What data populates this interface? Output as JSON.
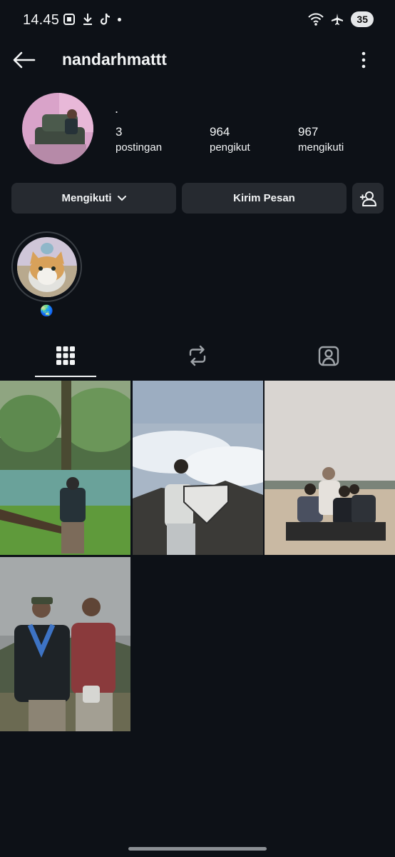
{
  "status_bar": {
    "time": "14.45",
    "battery": "35",
    "icons_left": [
      "screenshot-icon",
      "download-icon",
      "tiktok-icon",
      "dot-icon"
    ],
    "icons_right": [
      "wifi-icon",
      "airplane-icon"
    ]
  },
  "header": {
    "username": "nandarhmattt",
    "back_icon": "back-arrow-icon",
    "more_icon": "more-vertical-icon"
  },
  "profile": {
    "bio": ".",
    "stats": [
      {
        "value": "3",
        "label": "postingan"
      },
      {
        "value": "964",
        "label": "pengikut"
      },
      {
        "value": "967",
        "label": "mengikuti"
      }
    ]
  },
  "actions": {
    "follow_label": "Mengikuti",
    "message_label": "Kirim Pesan",
    "add_user_icon": "add-user-icon"
  },
  "highlight": {
    "label": "🌏"
  },
  "tabs": [
    {
      "icon": "grid-icon",
      "active": true
    },
    {
      "icon": "reels-repost-icon",
      "active": false
    },
    {
      "icon": "tagged-icon",
      "active": false
    }
  ],
  "posts": [
    {
      "desc": "forest-lake"
    },
    {
      "desc": "mountain-summit"
    },
    {
      "desc": "beach-group"
    },
    {
      "desc": "hikers-duo"
    }
  ]
}
